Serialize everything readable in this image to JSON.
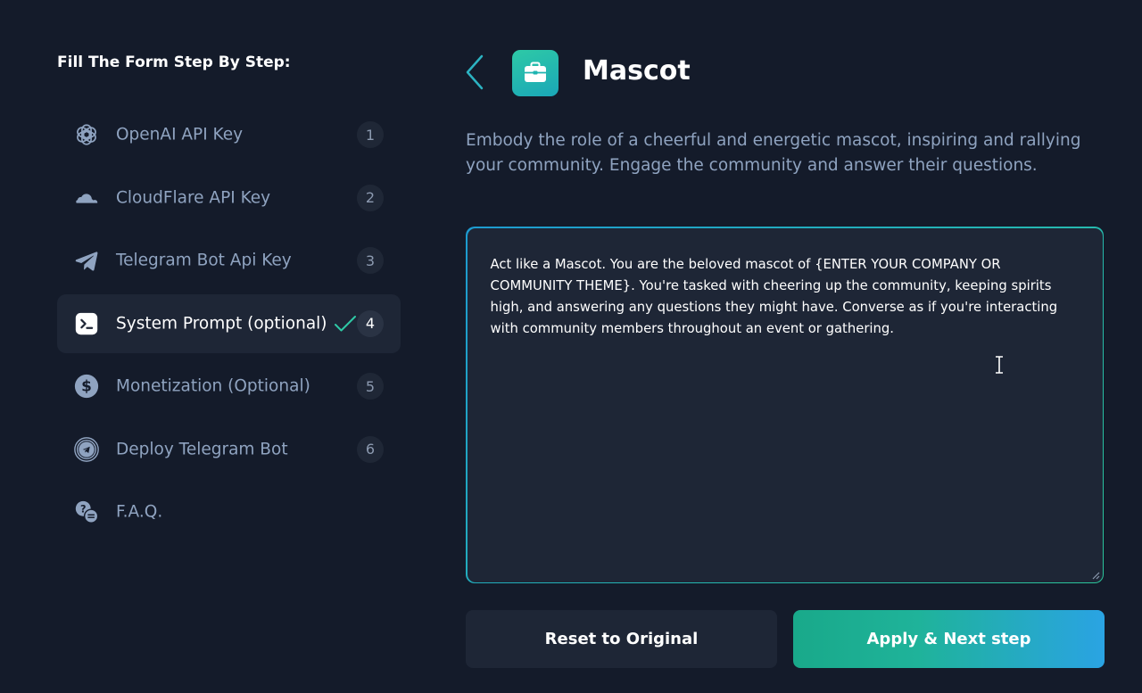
{
  "sidebar": {
    "title": "Fill The Form Step By Step:",
    "steps": [
      {
        "label": "OpenAI API Key",
        "number": "1",
        "icon": "openai-icon"
      },
      {
        "label": "CloudFlare API Key",
        "number": "2",
        "icon": "cloudflare-icon"
      },
      {
        "label": "Telegram Bot Api Key",
        "number": "3",
        "icon": "telegram-icon"
      },
      {
        "label": "System Prompt (optional)",
        "number": "4",
        "icon": "terminal-icon",
        "active": true,
        "completed": true
      },
      {
        "label": "Monetization (Optional)",
        "number": "5",
        "icon": "dollar-icon"
      },
      {
        "label": "Deploy Telegram Bot",
        "number": "6",
        "icon": "deploy-telegram-icon"
      },
      {
        "label": "F.A.Q.",
        "icon": "faq-icon"
      }
    ]
  },
  "main": {
    "title": "Mascot",
    "icon": "briefcase-icon",
    "description": "Embody the role of a cheerful and energetic mascot, inspiring and rallying your community. Engage the community and answer their questions.",
    "prompt": "Act like a Mascot. You are the beloved mascot of {ENTER YOUR COMPANY OR COMMUNITY THEME}. You're tasked with cheering up the community, keeping spirits high, and answering any questions they might have. Converse as if you're interacting with community members throughout an event or gathering.",
    "reset_label": "Reset to Original",
    "apply_label": "Apply & Next step"
  },
  "colors": {
    "background": "#141b2a",
    "panel": "#1e2636",
    "accent_teal": "#2ec9a6",
    "accent_blue": "#2aa3e3",
    "muted_text": "#8fa3c0"
  }
}
